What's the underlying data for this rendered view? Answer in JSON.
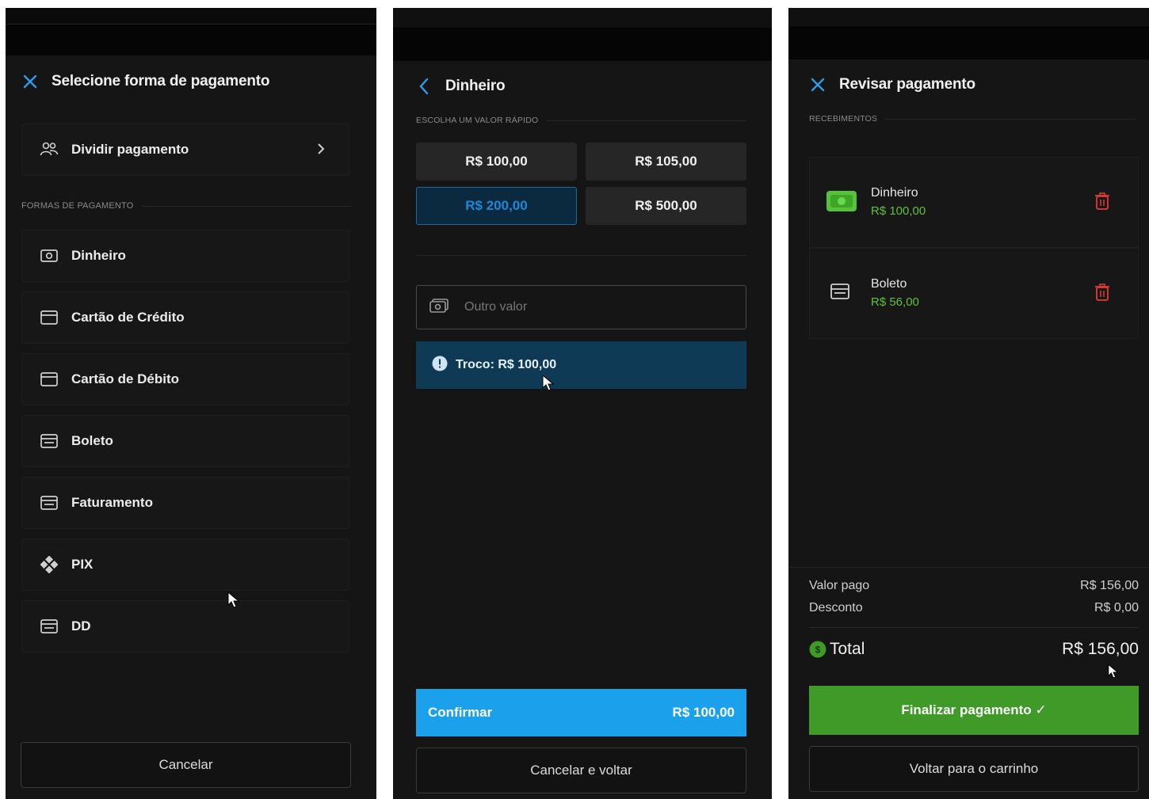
{
  "panel1": {
    "title": "Selecione forma de pagamento",
    "split": {
      "label": "Dividir pagamento"
    },
    "section_label": "FORMAS DE PAGAMENTO",
    "methods": [
      {
        "label": "Dinheiro",
        "icon": "cash-icon"
      },
      {
        "label": "Cartão de Crédito",
        "icon": "credit-card-icon"
      },
      {
        "label": "Cartão de Débito",
        "icon": "credit-card-icon"
      },
      {
        "label": "Boleto",
        "icon": "boleto-icon"
      },
      {
        "label": "Faturamento",
        "icon": "invoice-icon"
      },
      {
        "label": "PIX",
        "icon": "pix-icon"
      },
      {
        "label": "DD",
        "icon": "boleto-icon"
      }
    ],
    "cancel_label": "Cancelar"
  },
  "panel2": {
    "title": "Dinheiro",
    "section_label": "ESCOLHA UM VALOR RÁPIDO",
    "quick_values": [
      "R$ 100,00",
      "R$ 105,00",
      "R$ 200,00",
      "R$ 500,00"
    ],
    "selected_quick_value": "R$ 200,00",
    "input_placeholder": "Outro valor",
    "change_text": "Troco: R$ 100,00",
    "confirm_label": "Confirmar",
    "confirm_amount": "R$ 100,00",
    "back_label": "Cancelar e voltar"
  },
  "panel3": {
    "title": "Revisar pagamento",
    "section_label": "RECEBIMENTOS",
    "receipts": [
      {
        "name": "Dinheiro",
        "value": "R$ 100,00",
        "icon": "cash-green-icon"
      },
      {
        "name": "Boleto",
        "value": "R$ 56,00",
        "icon": "boleto-icon"
      }
    ],
    "paid_label": "Valor pago",
    "paid_value": "R$ 156,00",
    "discount_label": "Desconto",
    "discount_value": "R$ 0,00",
    "total_label": "Total",
    "total_value": "R$ 156,00",
    "finish_label": "Finalizar pagamento ✓",
    "cart_label": "Voltar para o carrinho"
  },
  "colors": {
    "accent_blue": "#1ba1ec",
    "accent_green": "#3f9a28",
    "value_green": "#62c03a",
    "danger_red": "#e53935",
    "info_bg": "#0e3a55"
  }
}
